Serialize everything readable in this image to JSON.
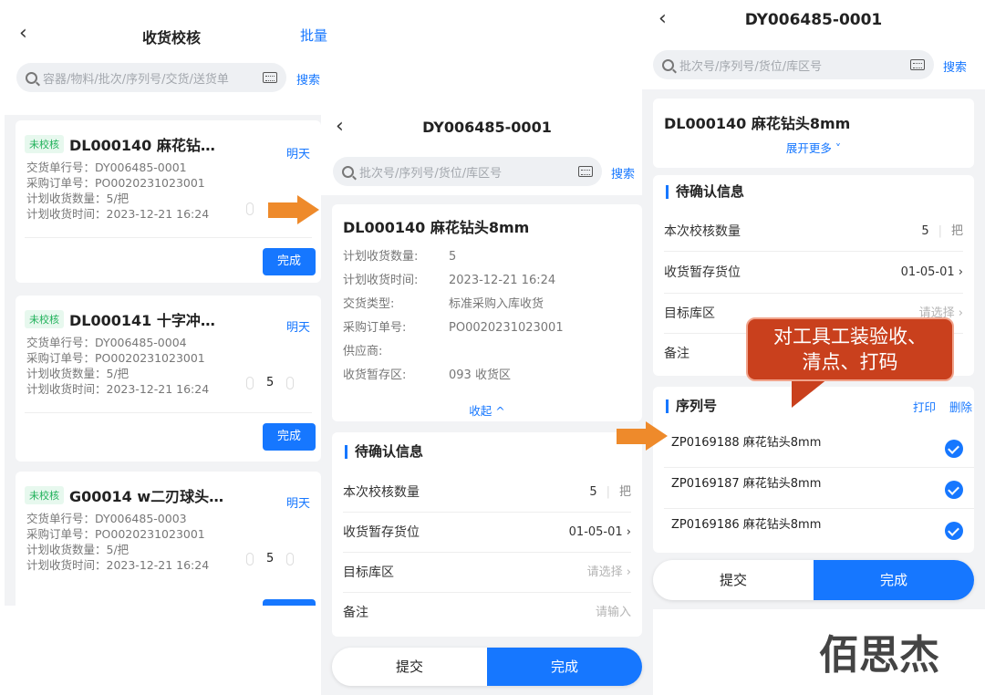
{
  "panel1": {
    "title": "收货校核",
    "batch": "批量",
    "search_placeholder": "容器/物料/批次/序列号/交货/送货单",
    "search_button": "搜索",
    "cards": [
      {
        "tag": "未校核",
        "title": "DL000140 麻花钻…",
        "right": "明天",
        "line1": "交货单行号：DY006485-0001",
        "line2": "采购订单号：PO0020231023001",
        "line3": "计划收货数量：5/把",
        "line4": "计划收货时间：2023-12-21 16:24",
        "qty": "",
        "button": "完成"
      },
      {
        "tag": "未校核",
        "title": "DL000141 十字冲…",
        "right": "明天",
        "line1": "交货单行号：DY006485-0004",
        "line2": "采购订单号：PO0020231023001",
        "line3": "计划收货数量：5/把",
        "line4": "计划收货时间：2023-12-21 16:24",
        "qty": "5",
        "button": "完成"
      },
      {
        "tag": "未校核",
        "title": "G00014 w二刃球头…",
        "right": "明天",
        "line1": "交货单行号：DY006485-0003",
        "line2": "采购订单号：PO0020231023001",
        "line3": "计划收货数量：5/把",
        "line4": "计划收货时间：2023-12-21 16:24",
        "qty": "5",
        "button": ""
      }
    ]
  },
  "panel2": {
    "title": "DY006485-0001",
    "search_placeholder": "批次号/序列号/货位/库区号",
    "search_button": "搜索",
    "card_title": "DL000140 麻花钻头8mm",
    "details": [
      {
        "k": "计划收货数量:",
        "v": "5"
      },
      {
        "k": "计划收货时间:",
        "v": "2023-12-21 16:24"
      },
      {
        "k": "交货类型:",
        "v": "标准采购入库收货"
      },
      {
        "k": "采购订单号:",
        "v": "PO0020231023001"
      },
      {
        "k": "供应商:",
        "v": ""
      },
      {
        "k": "收货暂存区:",
        "v": "093 收货区"
      }
    ],
    "collapse": "收起 ^",
    "section": "待确认信息",
    "rows": [
      {
        "k": "本次校核数量",
        "v": "5",
        "unit": "把"
      },
      {
        "k": "收货暂存货位",
        "v": "01-05-01 ›"
      },
      {
        "k": "目标库区",
        "v": "请选择 ›"
      },
      {
        "k": "备注",
        "v": "请输入"
      }
    ],
    "submit": "提交",
    "done": "完成"
  },
  "panel3": {
    "title": "DY006485-0001",
    "search_placeholder": "批次号/序列号/货位/库区号",
    "search_button": "搜索",
    "card_title": "DL000140 麻花钻头8mm",
    "expand": "展开更多 ˅",
    "section": "待确认信息",
    "rows": [
      {
        "k": "本次校核数量",
        "v": "5",
        "unit": "把"
      },
      {
        "k": "收货暂存货位",
        "v": "01-05-01 ›"
      },
      {
        "k": "目标库区",
        "v": "请选择 ›"
      },
      {
        "k": "备注",
        "v": ""
      }
    ],
    "serial_section": "序列号",
    "print": "打印",
    "delete": "删除",
    "serials": [
      "ZP0169188 麻花钻头8mm",
      "ZP0169187 麻花钻头8mm",
      "ZP0169186 麻花钻头8mm"
    ],
    "submit": "提交",
    "done": "完成"
  },
  "callout": {
    "line1": "对工具工装验收、",
    "line2": "清点、打码"
  },
  "brand": "佰思杰",
  "colors": {
    "accent": "#1677ff",
    "arrow": "#ee8a2b",
    "callout": "#c9401d",
    "tag_bg": "#e7f8ee",
    "tag_text": "#20b15a"
  }
}
